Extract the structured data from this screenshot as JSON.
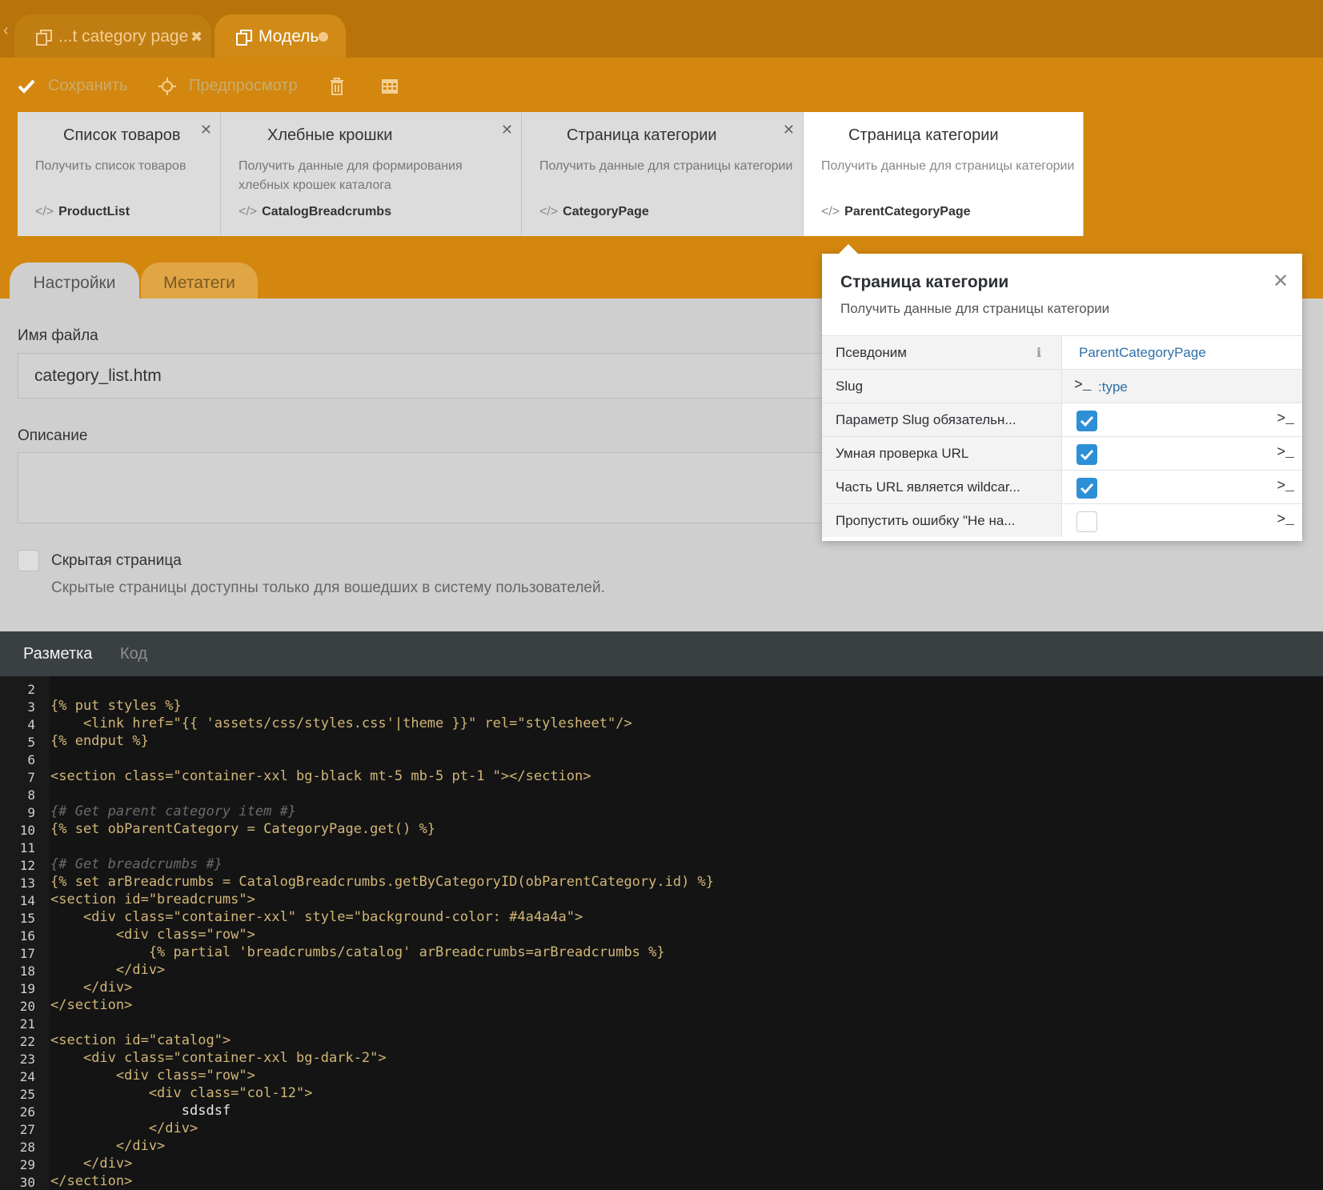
{
  "tabs": [
    {
      "label": "...t category page",
      "active": false
    },
    {
      "label": "Модель",
      "active": true
    }
  ],
  "toolbar": {
    "save": "Сохранить",
    "preview": "Предпросмотр"
  },
  "components": [
    {
      "title": "Список товаров",
      "description": "Получить список товаров",
      "alias": "ProductList"
    },
    {
      "title": "Хлебные крошки",
      "description": "Получить данные для формирования хлебных крошек каталога",
      "alias": "CatalogBreadcrumbs"
    },
    {
      "title": "Страница категории",
      "description": "Получить данные для страницы категории",
      "alias": "CategoryPage"
    },
    {
      "title": "Страница категории",
      "description": "Получить данные для страницы категории",
      "alias": "ParentCategoryPage"
    }
  ],
  "settings_tabs": [
    "Настройки",
    "Метатеги"
  ],
  "form": {
    "filename_label": "Имя файла",
    "filename_value": "category_list.htm",
    "description_label": "Описание",
    "hidden_label": "Скрытая страница",
    "hidden_help": "Скрытые страницы доступны только для вошедших в систему пользователей."
  },
  "inspector": {
    "title": "Страница категории",
    "description": "Получить данные для страницы категории",
    "rows": [
      {
        "label": "Псевдоним",
        "value": "ParentCategoryPage"
      },
      {
        "label": "Slug",
        "value": ":type"
      },
      {
        "label": "Параметр Slug обязательн...",
        "checked": true
      },
      {
        "label": "Умная проверка URL",
        "checked": true
      },
      {
        "label": "Часть URL является wildcar...",
        "checked": true
      },
      {
        "label": "Пропустить ошибку \"Не на...",
        "checked": false
      }
    ]
  },
  "editor": {
    "tabs": [
      "Разметка",
      "Код"
    ],
    "first_line": 2,
    "lines": [
      "",
      "{% put styles %}",
      "    <link href=\"{{ 'assets/css/styles.css'|theme }}\" rel=\"stylesheet\"/>",
      "{% endput %}",
      "",
      "<section class=\"container-xxl bg-black mt-5 mb-5 pt-1 \"></section>",
      "",
      "{# Get parent category item #}",
      "{% set obParentCategory = CategoryPage.get() %}",
      "",
      "{# Get breadcrumbs #}",
      "{% set arBreadcrumbs = CatalogBreadcrumbs.getByCategoryID(obParentCategory.id) %}",
      "<section id=\"breadcrums\">",
      "    <div class=\"container-xxl\" style=\"background-color: #4a4a4a\">",
      "        <div class=\"row\">",
      "            {% partial 'breadcrumbs/catalog' arBreadcrumbs=arBreadcrumbs %}",
      "        </div>",
      "    </div>",
      "</section>",
      "",
      "<section id=\"catalog\">",
      "    <div class=\"container-xxl bg-dark-2\">",
      "        <div class=\"row\">",
      "            <div class=\"col-12\">",
      "                sdsdsf",
      "            </div>",
      "        </div>",
      "    </div>",
      "</section>"
    ]
  }
}
